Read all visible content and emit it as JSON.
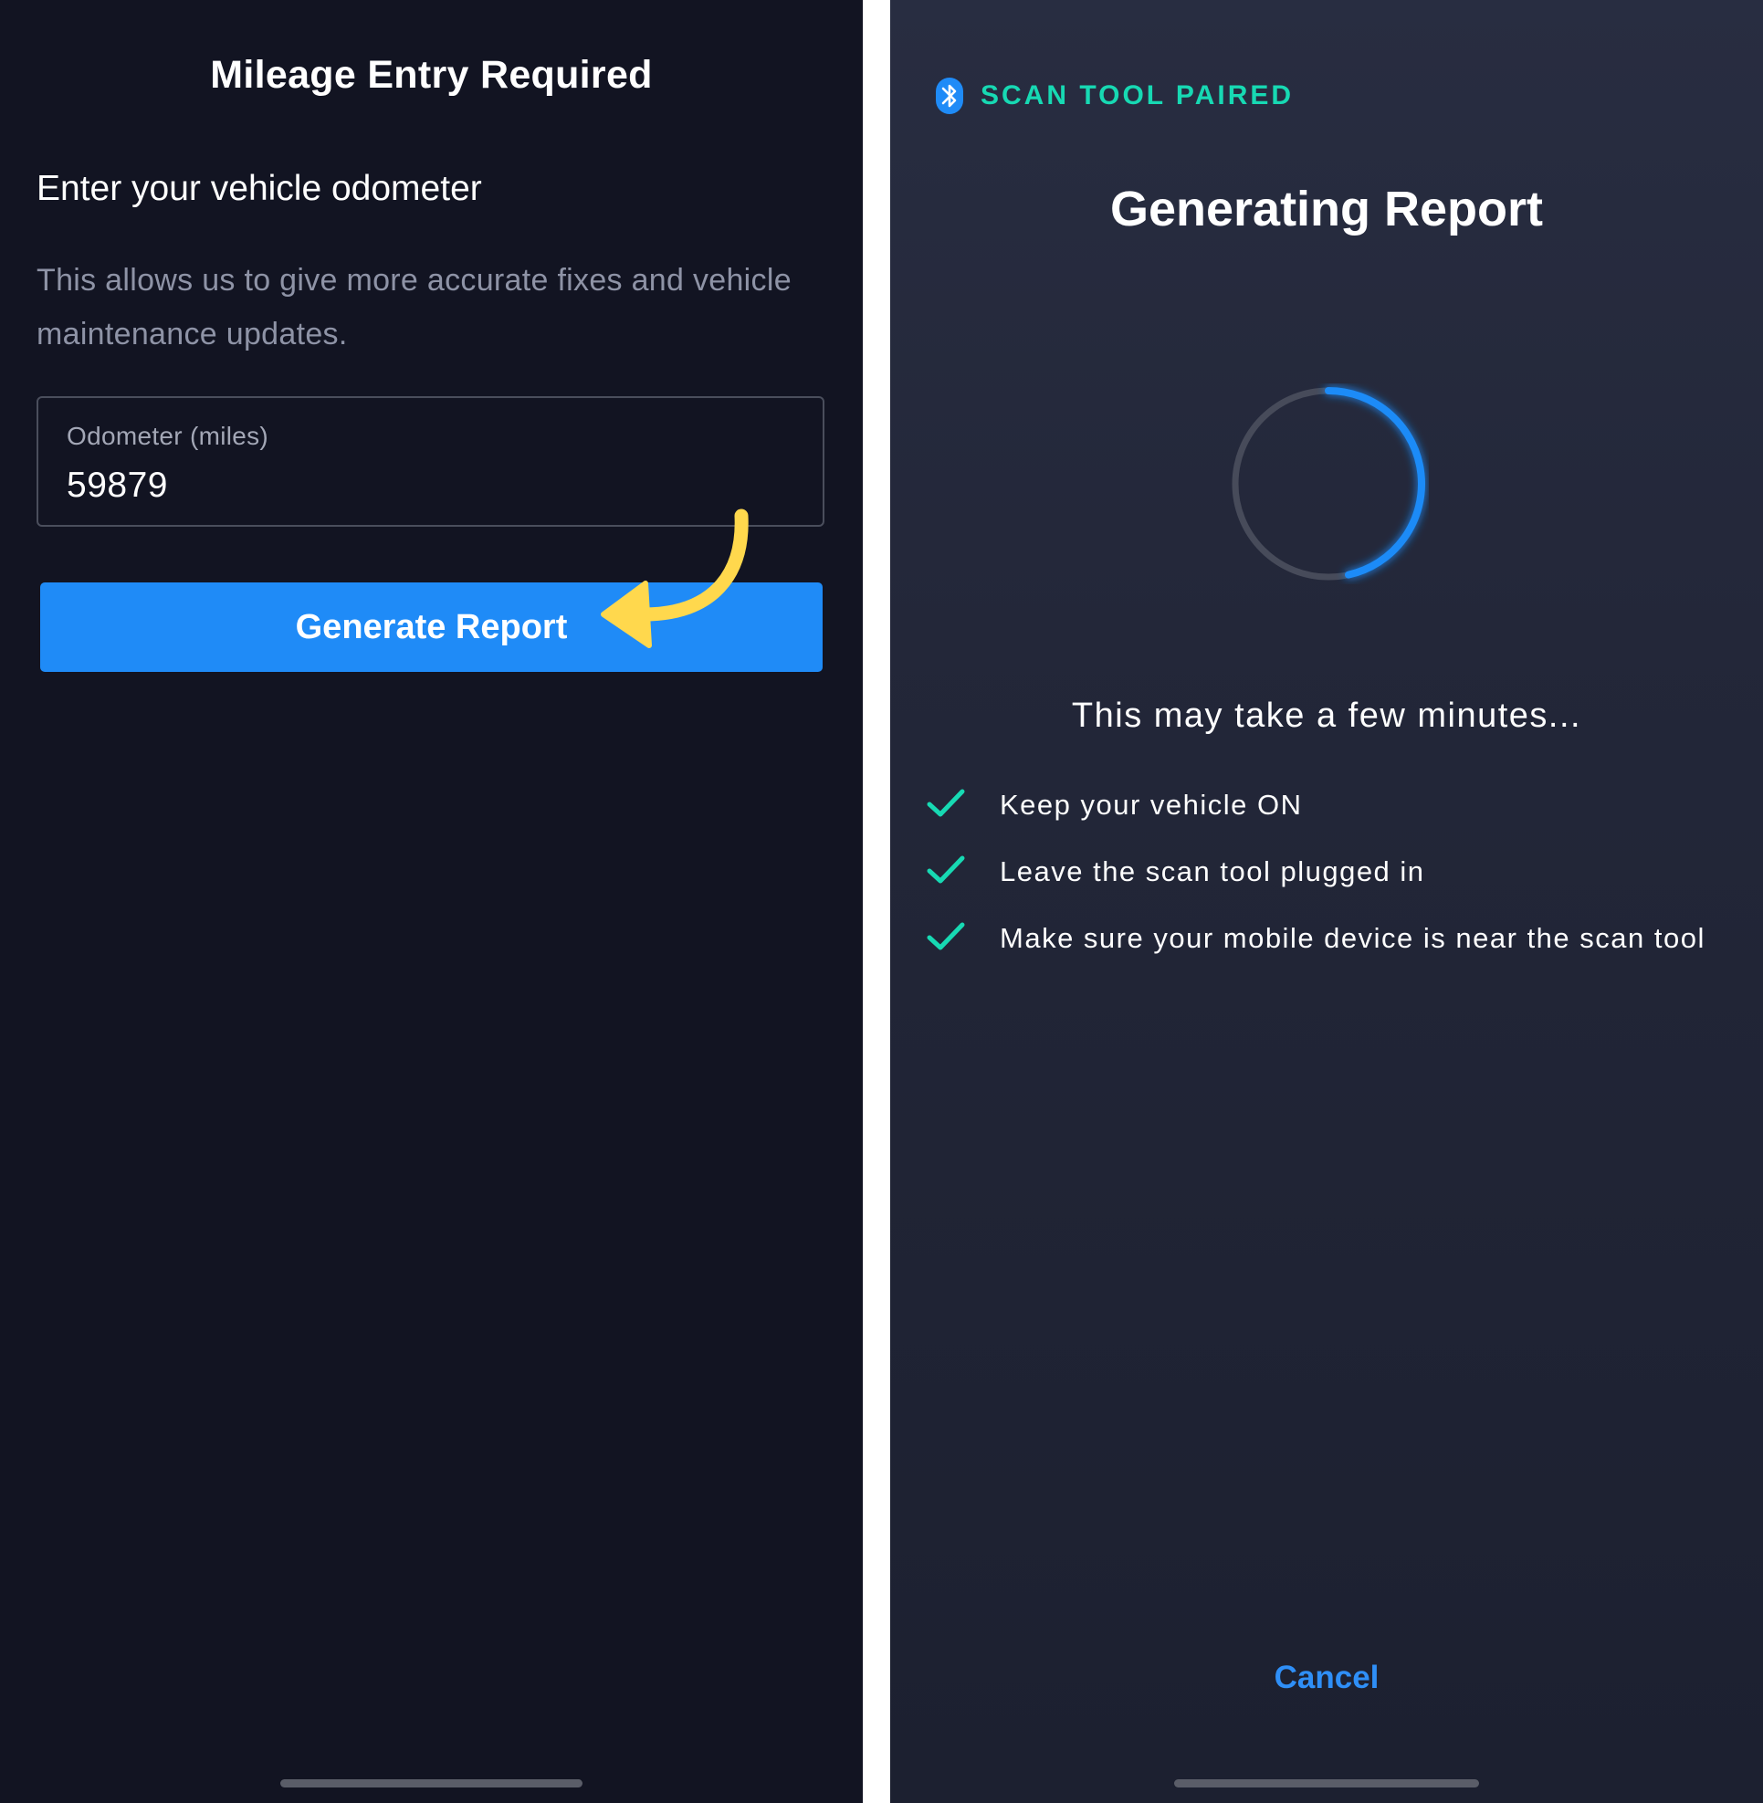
{
  "left": {
    "title": "Mileage Entry Required",
    "heading": "Enter your vehicle odometer",
    "description": "This allows us to give more accurate fixes and vehicle maintenance updates.",
    "odometer": {
      "label": "Odometer (miles)",
      "value": "59879"
    },
    "generate_button": "Generate Report",
    "annotation_arrow_color": "#ffd84d",
    "button_color": "#1f8bf7"
  },
  "right": {
    "status": "SCAN TOOL PAIRED",
    "status_icon": "bluetooth-icon",
    "status_color": "#17d9b3",
    "title": "Generating Report",
    "subtitle": "This may take a few minutes...",
    "tips": [
      "Keep your vehicle ON",
      "Leave the scan tool plugged in",
      "Make sure your mobile device is near the scan tool"
    ],
    "tip_icon": "check-icon",
    "cancel": "Cancel",
    "spinner_color": "#1f8bf7"
  }
}
